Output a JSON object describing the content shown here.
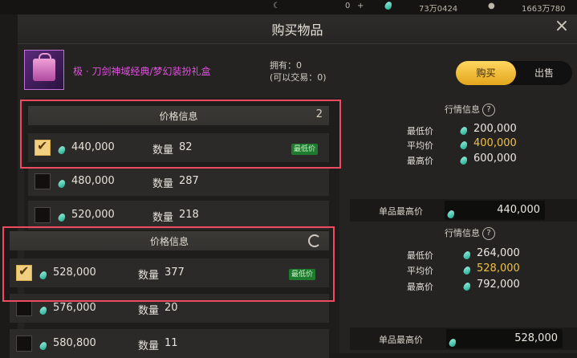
{
  "topbar": {
    "val1": "0",
    "val2": "73万0424",
    "val3": "1663万780"
  },
  "dialog": {
    "title": "购买物品",
    "close": "×"
  },
  "item": {
    "name": "极 · 刀剑神域经典/梦幻装扮礼盒",
    "own_line1": "拥有：0",
    "own_line2": "(可以交易：0)"
  },
  "tabs": {
    "buy": "购买",
    "sell": "出售"
  },
  "section1": {
    "title": "价格信息",
    "count": "2",
    "rows": [
      {
        "price": "440,000",
        "qty_label": "数量",
        "qty": "82",
        "badge": "最低价",
        "checked": true
      },
      {
        "price": "480,000",
        "qty_label": "数量",
        "qty": "287",
        "checked": false
      },
      {
        "price": "520,000",
        "qty_label": "数量",
        "qty": "218",
        "checked": false
      }
    ]
  },
  "section2": {
    "title": "价格信息",
    "rows": [
      {
        "price": "528,000",
        "qty_label": "数量",
        "qty": "377",
        "badge": "最低价",
        "checked": true
      },
      {
        "price": "576,000",
        "qty_label": "数量",
        "qty": "20",
        "checked": false
      },
      {
        "price": "580,800",
        "qty_label": "数量",
        "qty": "11",
        "checked": false
      }
    ]
  },
  "market1": {
    "title": "行情信息",
    "min_label": "最低价",
    "min": "200,000",
    "avg_label": "平均价",
    "avg": "400,000",
    "max_label": "最高价",
    "max": "600,000",
    "unit_max_label": "单品最高价",
    "unit_max": "440,000"
  },
  "market2": {
    "title": "行情信息",
    "min_label": "最低价",
    "min": "264,000",
    "avg_label": "平均价",
    "avg": "528,000",
    "max_label": "最高价",
    "max": "792,000",
    "unit_max_label": "单品最高价",
    "unit_max": "528,000"
  },
  "colors": {
    "accent": "#f0d080",
    "highlight": "#f04a60",
    "avg_value": "#f0c040",
    "badge": "#1e7a2c"
  },
  "icons": [
    "gem-icon",
    "question-icon",
    "refresh-icon",
    "close-icon",
    "checkmark-icon"
  ]
}
